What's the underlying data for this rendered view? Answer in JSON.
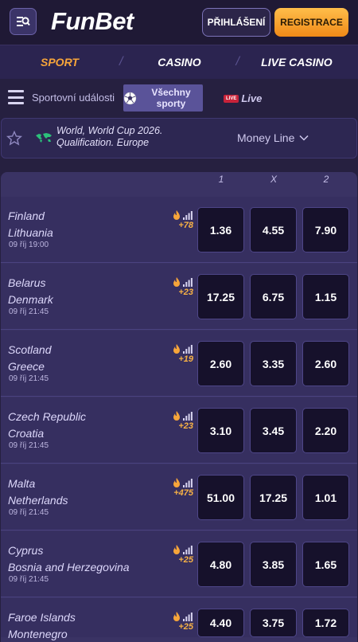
{
  "header": {
    "logo": "FunBet",
    "login_label": "PŘIHLÁŠENÍ",
    "register_label": "REGISTRACE"
  },
  "main_tabs": [
    {
      "label": "SPORT",
      "active": true
    },
    {
      "label": "CASINO",
      "active": false
    },
    {
      "label": "LIVE CASINO",
      "active": false
    }
  ],
  "sub_nav": {
    "sports_events_label": "Sportovní události",
    "all_sports_label": "Všechny sporty",
    "live_badge": "LIVE",
    "live_label": "Live"
  },
  "competition": {
    "name_line1": "World, World Cup 2026.",
    "name_line2": "Qualification. Europe",
    "market": "Money Line"
  },
  "columns": [
    "1",
    "X",
    "2"
  ],
  "matches": [
    {
      "home": "Finland",
      "away": "Lithuania",
      "date": "09 říj 19:00",
      "more": "+78",
      "odds": [
        "1.36",
        "4.55",
        "7.90"
      ]
    },
    {
      "home": "Belarus",
      "away": "Denmark",
      "date": "09 říj 21:45",
      "more": "+23",
      "odds": [
        "17.25",
        "6.75",
        "1.15"
      ]
    },
    {
      "home": "Scotland",
      "away": "Greece",
      "date": "09 říj 21:45",
      "more": "+19",
      "odds": [
        "2.60",
        "3.35",
        "2.60"
      ]
    },
    {
      "home": "Czech Republic",
      "away": "Croatia",
      "date": "09 říj 21:45",
      "more": "+23",
      "odds": [
        "3.10",
        "3.45",
        "2.20"
      ]
    },
    {
      "home": "Malta",
      "away": "Netherlands",
      "date": "09 říj 21:45",
      "more": "+475",
      "odds": [
        "51.00",
        "17.25",
        "1.01"
      ]
    },
    {
      "home": "Cyprus",
      "away": "Bosnia and Herzegovina",
      "date": "09 říj 21:45",
      "more": "+25",
      "odds": [
        "4.80",
        "3.85",
        "1.65"
      ]
    },
    {
      "home": "Faroe Islands",
      "away": "Montenegro",
      "date": "",
      "more": "+25",
      "odds": [
        "4.40",
        "3.75",
        "1.72"
      ]
    }
  ],
  "colors": {
    "accent_orange": "#f7a53a",
    "background": "#262040",
    "odds_button": "#16112b"
  }
}
